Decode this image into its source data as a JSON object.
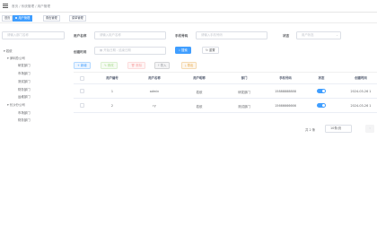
{
  "header": {
    "breadcrumb": "首页 / 系统管理 / 用户管理"
  },
  "tags": [
    "首页",
    "用户管理",
    "角色管理",
    "菜单管理"
  ],
  "dept_search": {
    "placeholder": "请输入部门名称"
  },
  "dept_tree": {
    "root": "若依",
    "children": [
      "深圳总公司",
      "研发部门",
      "市场部门",
      "测试部门",
      "财务部门",
      "运维部门",
      "长沙分公司",
      "市场部门",
      "财务部门"
    ]
  },
  "filters": {
    "username": {
      "label": "用户名称",
      "placeholder": "请输入用户名称"
    },
    "phone": {
      "label": "手机号码",
      "placeholder": "请输入手机号码"
    },
    "status": {
      "label": "状态",
      "placeholder": "用户状态"
    },
    "date": {
      "label": "创建时间",
      "start": "开始日期",
      "sep": "-",
      "end": "结束日期"
    }
  },
  "buttons": {
    "search": "搜索",
    "reset": "重置",
    "add": "新增",
    "edit": "修改",
    "delete": "删除",
    "import": "导入",
    "export": "导出"
  },
  "table": {
    "columns": [
      "用户编号",
      "用户名称",
      "用户昵称",
      "部门",
      "手机号码",
      "状态",
      "创建时间"
    ],
    "rows": [
      {
        "id": "1",
        "username": "admin",
        "nickname": "若依",
        "dept": "研发部门",
        "phone": "15888888888",
        "status": true,
        "created": "2024-03-26 1"
      },
      {
        "id": "2",
        "username": "ry",
        "nickname": "若依",
        "dept": "测试部门",
        "phone": "15666666666",
        "status": true,
        "created": "2024-03-26 1"
      }
    ]
  },
  "pagination": {
    "total": "共 2 条",
    "page_size": "10条/页"
  },
  "colors": {
    "primary": "#409eff"
  }
}
